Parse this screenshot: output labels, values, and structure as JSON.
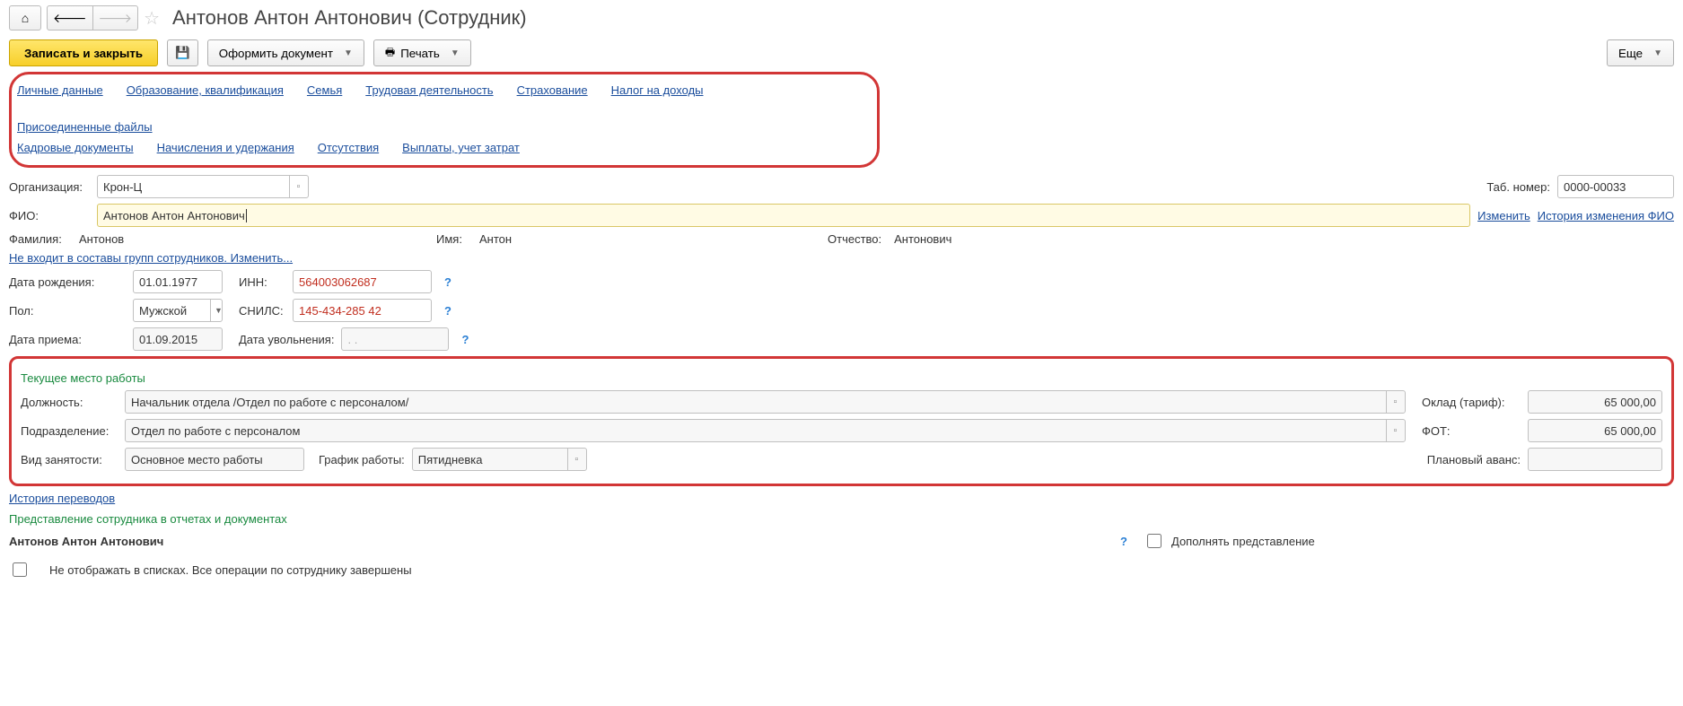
{
  "title": "Антонов Антон Антонович (Сотрудник)",
  "toolbar": {
    "save_close": "Записать и закрыть",
    "doc": "Оформить документ",
    "print": "Печать",
    "more": "Еще"
  },
  "links": {
    "personal": "Личные данные",
    "education": "Образование, квалификация",
    "family": "Семья",
    "labor": "Трудовая деятельность",
    "insurance": "Страхование",
    "income_tax": "Налог на доходы",
    "files": "Присоединенные файлы",
    "hr_docs": "Кадровые документы",
    "accruals": "Начисления и удержания",
    "absence": "Отсутствия",
    "payouts": "Выплаты, учет затрат"
  },
  "labels": {
    "org": "Организация:",
    "tab_no": "Таб. номер:",
    "fio": "ФИО:",
    "change": "Изменить",
    "fio_history": "История изменения ФИО",
    "lastname": "Фамилия:",
    "firstname": "Имя:",
    "middlename": "Отчество:",
    "not_in_groups": "Не входит в составы групп сотрудников. Изменить...",
    "birthdate": "Дата рождения:",
    "inn": "ИНН:",
    "sex": "Пол:",
    "snils": "СНИЛС:",
    "hire_date": "Дата приема:",
    "fire_date": "Дата увольнения:",
    "current_job": "Текущее место работы",
    "position": "Должность:",
    "salary": "Оклад (тариф):",
    "department": "Подразделение:",
    "fot": "ФОТ:",
    "emp_type": "Вид занятости:",
    "schedule": "График работы:",
    "advance": "Плановый аванс:",
    "transfer_history": "История переводов",
    "repr_section": "Представление сотрудника в отчетах и документах",
    "add_repr": "Дополнять представление",
    "hide_in_lists": "Не отображать в списках. Все операции по сотруднику завершены"
  },
  "values": {
    "org": "Крон-Ц",
    "tab_no": "0000-00033",
    "fio": "Антонов Антон Антонович",
    "lastname": "Антонов",
    "firstname": "Антон",
    "middlename": "Антонович",
    "birthdate": "01.01.1977",
    "inn": "564003062687",
    "sex": "Мужской",
    "snils": "145-434-285 42",
    "hire_date": "01.09.2015",
    "fire_date": " .  .    ",
    "position": "Начальник отдела /Отдел по работе с персоналом/",
    "salary": "65 000,00",
    "department": "Отдел по работе с персоналом",
    "fot": "65 000,00",
    "emp_type": "Основное место работы",
    "schedule": "Пятидневка",
    "advance": "",
    "repr_name": "Антонов Антон Антонович"
  }
}
